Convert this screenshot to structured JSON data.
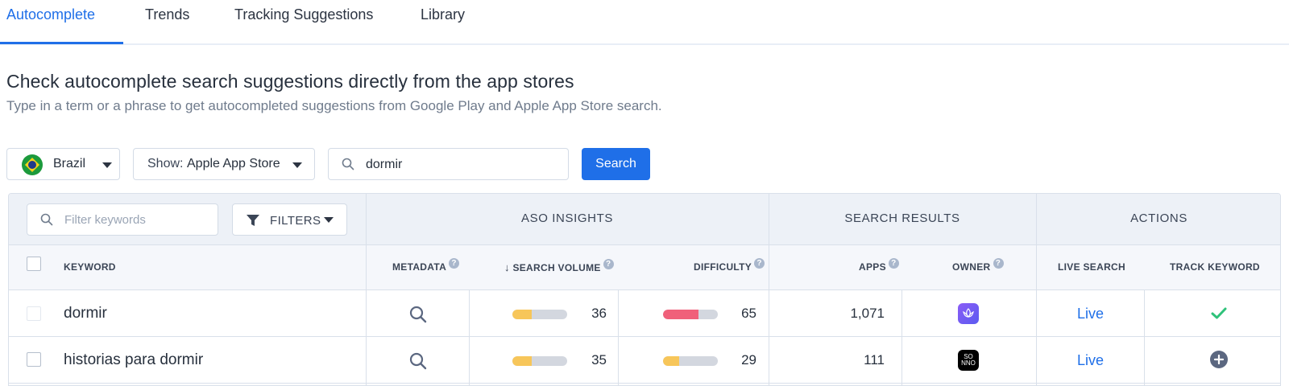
{
  "tabs": [
    {
      "label": "Autocomplete",
      "active": true
    },
    {
      "label": "Trends",
      "active": false
    },
    {
      "label": "Tracking Suggestions",
      "active": false
    },
    {
      "label": "Library",
      "active": false
    }
  ],
  "heading": {
    "title": "Check autocomplete search suggestions directly from the app stores",
    "subtitle": "Type in a term or a phrase to get autocompleted suggestions from Google Play and Apple App Store search."
  },
  "controls": {
    "country": "Brazil",
    "store_prefix": "Show:",
    "store": "Apple App Store",
    "search_value": "dormir",
    "search_button": "Search"
  },
  "table": {
    "filter_placeholder": "Filter keywords",
    "filters_label": "FILTERS",
    "groups": {
      "aso": "ASO INSIGHTS",
      "search_results": "SEARCH RESULTS",
      "actions": "ACTIONS"
    },
    "columns": {
      "keyword": "KEYWORD",
      "metadata": "METADATA",
      "search_volume": "SEARCH VOLUME",
      "difficulty": "DIFFICULTY",
      "apps": "APPS",
      "owner": "OWNER",
      "live_search": "LIVE SEARCH",
      "track_keyword": "TRACK KEYWORD"
    },
    "rows": [
      {
        "keyword": "dormir",
        "search_volume": "36",
        "search_volume_fill": 0.36,
        "difficulty": "65",
        "difficulty_fill": 0.65,
        "apps": "1,071",
        "live": "Live",
        "tracked": true
      },
      {
        "keyword": "historias para dormir",
        "search_volume": "35",
        "search_volume_fill": 0.35,
        "difficulty": "29",
        "difficulty_fill": 0.29,
        "apps": "111",
        "owner_icon_text": "SO\nNNO",
        "live": "Live",
        "tracked": false
      }
    ]
  },
  "colors": {
    "accent": "#1f6fe8",
    "volume_bar": "#f7c65a",
    "difficulty_high": "#f0607a",
    "difficulty_low": "#f7c65a",
    "tracked_check": "#2fc27a"
  }
}
